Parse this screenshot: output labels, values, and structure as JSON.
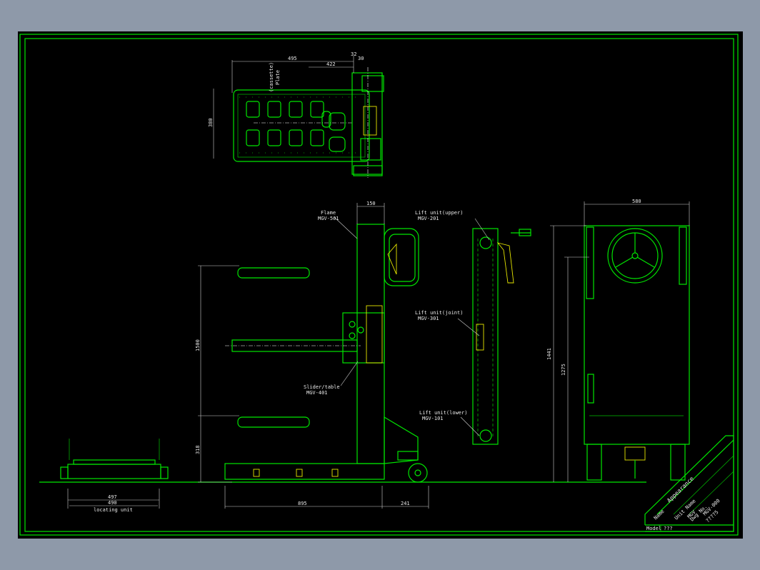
{
  "top_view": {
    "dim_width": "495",
    "dim_inner": "422",
    "dim_small_a": "32",
    "dim_small_b": "30",
    "dim_height": "380",
    "label_line1": "(cassette)",
    "label_line2": "Plate"
  },
  "side_view": {
    "dim_top": "150",
    "dim_height": "1500",
    "dim_low": "318",
    "dim_base": "895",
    "dim_wheel": "241",
    "notes": [
      {
        "title": "Flame",
        "code": "MGV-501"
      },
      {
        "title": "Slider/table",
        "code": "MGV-401"
      }
    ]
  },
  "lift_view": {
    "notes": [
      {
        "title": "Lift unit(upper)",
        "code": "MGV-201"
      },
      {
        "title": "Lift unit(joint)",
        "code": "MGV-301"
      },
      {
        "title": "Lift unit(lower)",
        "code": "MGV-101"
      }
    ]
  },
  "front_view": {
    "dim_width": "580",
    "dim_total": "1441",
    "dim_mid": "1275"
  },
  "locating_unit": {
    "dim_outer": "497",
    "dim_inner": "490",
    "caption": "locating unit"
  },
  "title_block": {
    "title": "Appearance",
    "name_label": "Name",
    "unit_label": "Unit Name",
    "unit_value": "MGV",
    "dwg_label": "Dwg No.",
    "dwg_value": "MGV-000",
    "num_value": "????5",
    "model_label": "Model",
    "model_value": "???"
  }
}
